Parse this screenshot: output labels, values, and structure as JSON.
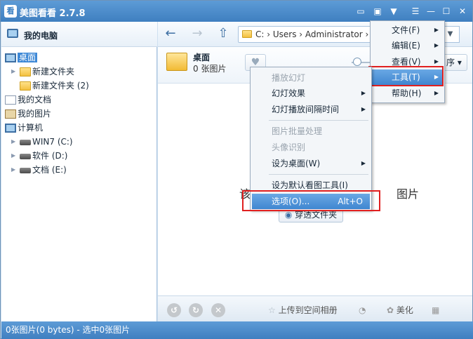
{
  "app": {
    "title": "美图看看 2.7.8",
    "icon_text": "看"
  },
  "titlebar_buttons": [
    "chat-icon",
    "skin-icon",
    "shirt-icon",
    "minimize-icon",
    "maximize-icon",
    "close-icon"
  ],
  "sidebar": {
    "header": "我的电脑",
    "items": [
      {
        "label": "桌面",
        "icon": "desktop-icon",
        "selected": true
      },
      {
        "label": "新建文件夹",
        "icon": "folder-icon"
      },
      {
        "label": "新建文件夹 (2)",
        "icon": "folder-icon"
      },
      {
        "label": "我的文档",
        "icon": "document-icon"
      },
      {
        "label": "我的图片",
        "icon": "pictures-icon"
      },
      {
        "label": "计算机",
        "icon": "computer-icon"
      },
      {
        "label": "WIN7 (C:)",
        "icon": "drive-icon"
      },
      {
        "label": "软件 (D:)",
        "icon": "drive-icon"
      },
      {
        "label": "文档 (E:)",
        "icon": "drive-icon"
      }
    ]
  },
  "toolbar": {
    "address": "C:  ›  Users  ›  Administrator  ›"
  },
  "folder": {
    "name": "桌面",
    "count": "0 张图片",
    "sort_label": "序"
  },
  "main": {
    "empty_text_left": "该",
    "empty_text_right": "图片",
    "through_button": "穿透文件夹"
  },
  "bottom": {
    "upload_label": "上传到空间相册",
    "beautify_label": "美化"
  },
  "status": "0张图片(0 bytes) - 选中0张图片",
  "main_menu": {
    "items": [
      {
        "label": "文件(F)"
      },
      {
        "label": "编辑(E)"
      },
      {
        "label": "查看(V)"
      },
      {
        "label": "工具(T)"
      },
      {
        "label": "帮助(H)"
      }
    ]
  },
  "tools_menu": {
    "items": [
      {
        "label": "播放幻灯",
        "disabled": true
      },
      {
        "label": "幻灯效果"
      },
      {
        "label": "幻灯播放间隔时间"
      },
      {
        "label": "图片批量处理",
        "disabled": true
      },
      {
        "label": "头像识别",
        "disabled": true
      },
      {
        "label": "设为桌面(W)"
      },
      {
        "label": "设为默认看图工具(I)"
      },
      {
        "label": "选项(O)...",
        "shortcut": "Alt+O"
      }
    ]
  },
  "colors": {
    "accent": "#3f86d0",
    "highlight_box": "#e02020"
  }
}
